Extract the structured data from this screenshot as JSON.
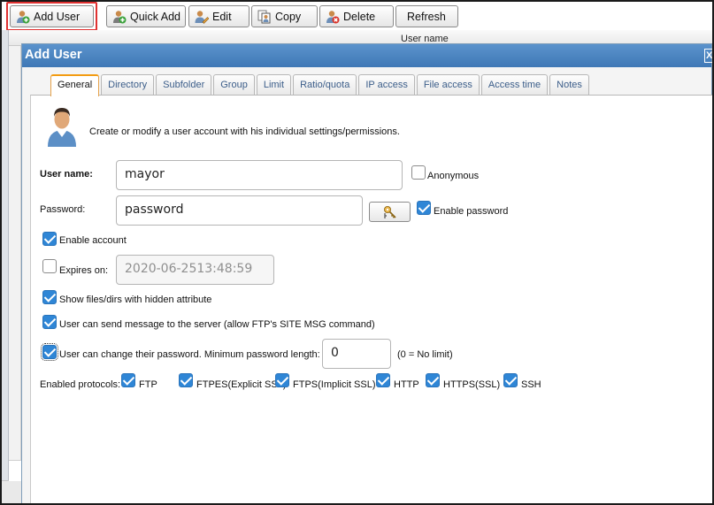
{
  "toolbar": {
    "add_user": "Add User",
    "quick_add": "Quick Add",
    "edit": "Edit",
    "copy": "Copy",
    "delete": "Delete",
    "refresh": "Refresh"
  },
  "grid": {
    "column_user_name": "User name"
  },
  "dialog": {
    "title": "Add User",
    "close_glyph": "X",
    "tabs": [
      "General",
      "Directory",
      "Subfolder",
      "Group",
      "Limit",
      "Ratio/quota",
      "IP access",
      "File access",
      "Access time",
      "Notes"
    ],
    "active_tab": "General",
    "intro": "Create or modify a user account with his individual settings/permissions.",
    "user_name_label": "User name:",
    "user_name_value": "mayor",
    "anonymous_label": "Anonymous",
    "anonymous_checked": false,
    "password_label": "Password:",
    "password_value": "password",
    "enable_password_label": "Enable password",
    "enable_password_checked": true,
    "enable_account_label": "Enable account",
    "enable_account_checked": true,
    "expires_label": "Expires on:",
    "expires_checked": false,
    "expires_value": "2020-06-2513:48:59",
    "hidden_files_label": "Show files/dirs with hidden attribute",
    "hidden_files_checked": true,
    "site_msg_label": "User can send message to the server (allow FTP's SITE MSG command)",
    "site_msg_checked": true,
    "change_pw_label": "User can change their password. Minimum password length:",
    "change_pw_checked": true,
    "min_pw_length": "0",
    "no_limit_note": "(0 = No limit)",
    "protocols_label": "Enabled protocols:",
    "protocols": [
      {
        "name": "FTP",
        "checked": true
      },
      {
        "name": "FTPES(Explicit SSL)",
        "checked": true
      },
      {
        "name": "FTPS(Implicit SSL)",
        "checked": true
      },
      {
        "name": "HTTP",
        "checked": true
      },
      {
        "name": "HTTPS(SSL)",
        "checked": true
      },
      {
        "name": "SSH",
        "checked": true
      }
    ]
  },
  "colors": {
    "title_bar": "#4a84c1",
    "checkbox_blue": "#2f86d6",
    "highlight_red": "#e03232",
    "active_tab_accent": "#f39c12"
  }
}
